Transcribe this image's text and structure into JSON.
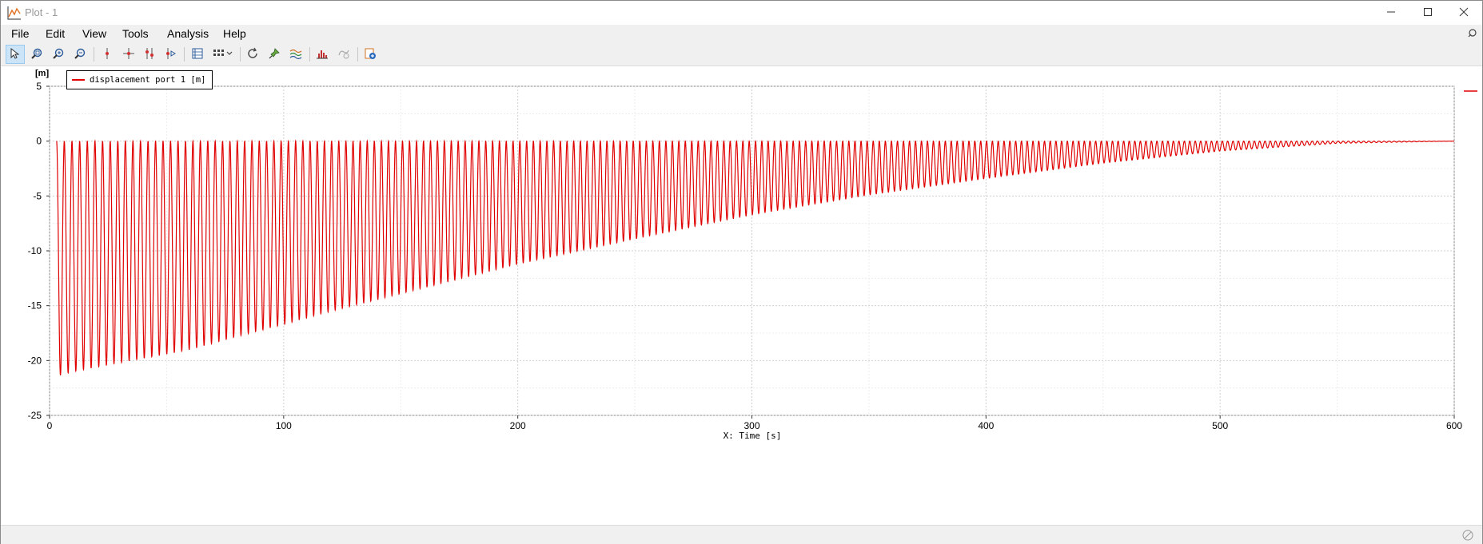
{
  "window": {
    "title": "Plot - 1",
    "minimize_icon": "minimize-icon",
    "maximize_icon": "maximize-icon",
    "close_icon": "close-icon"
  },
  "menu": {
    "items": [
      "File",
      "Edit",
      "View",
      "Tools",
      "Analysis",
      "Help"
    ]
  },
  "toolbar": {
    "icons": [
      "pointer-icon",
      "zoom-box-icon",
      "zoom-in-icon",
      "zoom-out-icon",
      "vertical-cursor-icon",
      "cross-cursor-icon",
      "double-cursor-icon",
      "play-cursor-icon",
      "table-icon",
      "grid-layout-icon",
      "refresh-icon",
      "pin-icon",
      "curves-icon",
      "histogram-icon",
      "lasso-icon",
      "add-plot-icon"
    ]
  },
  "colors": {
    "series": "#e00000",
    "grid": "#d8d8d8",
    "active_tool": "#cce4f7"
  },
  "chart_data": {
    "type": "line",
    "title": "",
    "ylabel": "[m]",
    "xlabel": "X: Time [s]",
    "xlim": [
      0,
      600
    ],
    "ylim": [
      -25,
      5
    ],
    "xticks": [
      0,
      100,
      200,
      300,
      400,
      500,
      600
    ],
    "yticks": [
      5,
      0,
      -5,
      -10,
      -15,
      -20,
      -25
    ],
    "grid": true,
    "legend_position": "top-left",
    "series": [
      {
        "name": "displacement port 1 [m]",
        "description_of_shape": "oscillation between 0 and a decaying trough envelope",
        "x": [
          2,
          10,
          20,
          40,
          60,
          80,
          100,
          120,
          150,
          200,
          250,
          300,
          350,
          400,
          450,
          500,
          550,
          600
        ],
        "trough_envelope": [
          -21.5,
          -21.0,
          -20.6,
          -19.8,
          -19.0,
          -17.8,
          -16.7,
          -15.5,
          -13.9,
          -11.2,
          -8.9,
          -6.7,
          -4.9,
          -3.4,
          -2.0,
          -0.9,
          -0.2,
          0.0
        ],
        "crest": 0
      }
    ]
  }
}
